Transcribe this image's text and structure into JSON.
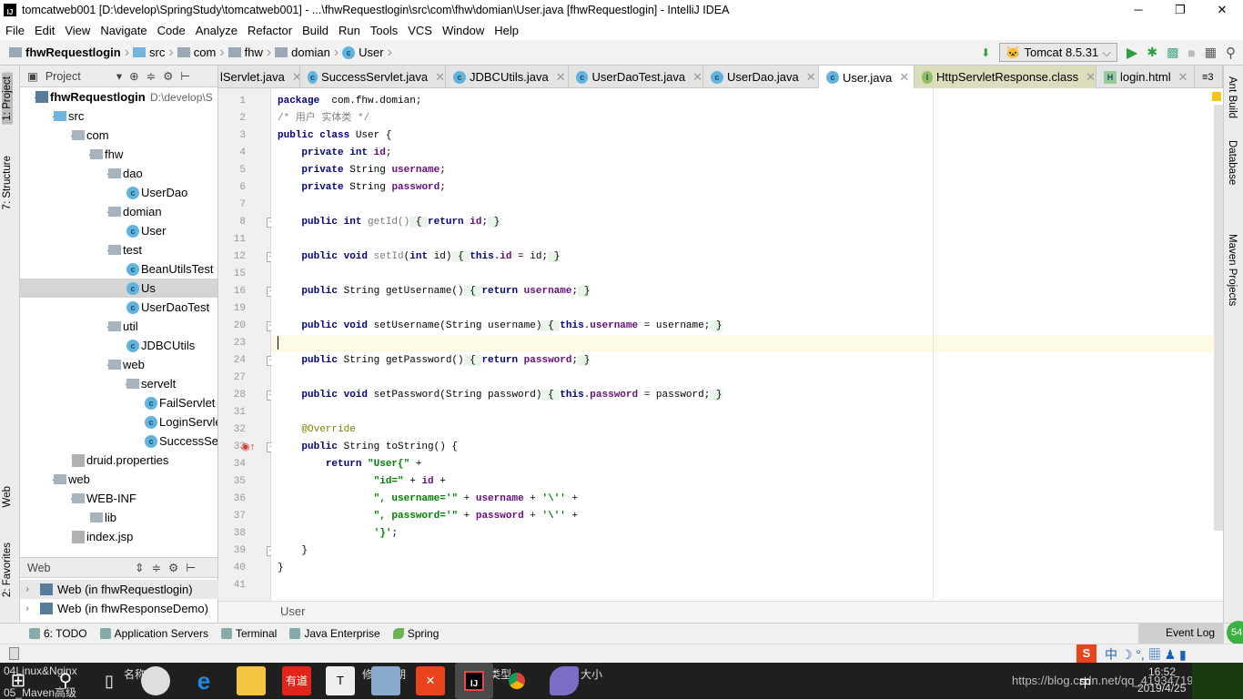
{
  "window": {
    "title": "tomcatweb001 [D:\\develop\\SpringStudy\\tomcatweb001] - ...\\fhwRequestlogin\\src\\com\\fhw\\domian\\User.java [fhwRequestlogin] - IntelliJ IDEA",
    "minimize": "─",
    "maximize": "❐",
    "close": "✕"
  },
  "menu": [
    "File",
    "Edit",
    "View",
    "Navigate",
    "Code",
    "Analyze",
    "Refactor",
    "Build",
    "Run",
    "Tools",
    "VCS",
    "Window",
    "Help"
  ],
  "breadcrumb": [
    "fhwRequestlogin",
    "src",
    "com",
    "fhw",
    "domian",
    "User"
  ],
  "run": {
    "config": "Tomcat 8.5.31"
  },
  "left_strip": [
    "1: Project",
    "7: Structure",
    "Web",
    "2: Favorites"
  ],
  "right_strip": [
    "Ant Build",
    "Database",
    "Maven Projects"
  ],
  "project": {
    "title": "Project",
    "root_path": "D:\\develop\\S",
    "tree": [
      {
        "label": "fhwRequestlogin",
        "depth": 0,
        "icon": "module",
        "exp": true,
        "bold": true
      },
      {
        "label": "src",
        "depth": 1,
        "icon": "src",
        "exp": true
      },
      {
        "label": "com",
        "depth": 2,
        "icon": "pkg",
        "exp": true
      },
      {
        "label": "fhw",
        "depth": 3,
        "icon": "pkg",
        "exp": true
      },
      {
        "label": "dao",
        "depth": 4,
        "icon": "pkg",
        "exp": true
      },
      {
        "label": "UserDao",
        "depth": 5,
        "icon": "class"
      },
      {
        "label": "domian",
        "depth": 4,
        "icon": "pkg",
        "exp": true
      },
      {
        "label": "User",
        "depth": 5,
        "icon": "class"
      },
      {
        "label": "test",
        "depth": 4,
        "icon": "pkg",
        "exp": true
      },
      {
        "label": "BeanUtilsTest",
        "depth": 5,
        "icon": "class"
      },
      {
        "label": "Us",
        "depth": 5,
        "icon": "class",
        "sel": true
      },
      {
        "label": "UserDaoTest",
        "depth": 5,
        "icon": "class"
      },
      {
        "label": "util",
        "depth": 4,
        "icon": "pkg",
        "exp": true
      },
      {
        "label": "JDBCUtils",
        "depth": 5,
        "icon": "class"
      },
      {
        "label": "web",
        "depth": 4,
        "icon": "pkg",
        "exp": true
      },
      {
        "label": "servelt",
        "depth": 5,
        "icon": "pkg",
        "exp": true
      },
      {
        "label": "FailServlet",
        "depth": 6,
        "icon": "class"
      },
      {
        "label": "LoginServle",
        "depth": 6,
        "icon": "class"
      },
      {
        "label": "SuccessSer",
        "depth": 6,
        "icon": "class"
      },
      {
        "label": "druid.properties",
        "depth": 2,
        "icon": "file"
      },
      {
        "label": "web",
        "depth": 1,
        "icon": "folder",
        "exp": true
      },
      {
        "label": "WEB-INF",
        "depth": 2,
        "icon": "folder",
        "exp": true
      },
      {
        "label": "lib",
        "depth": 3,
        "icon": "folder",
        "exp": false
      },
      {
        "label": "index.jsp",
        "depth": 2,
        "icon": "file"
      }
    ]
  },
  "web_panel": {
    "title": "Web",
    "items": [
      "Web (in fhwRequestlogin)",
      "Web (in fhwResponseDemo)"
    ]
  },
  "tabs": [
    {
      "label": "lServlet.java",
      "kind": "class"
    },
    {
      "label": "SuccessServlet.java",
      "kind": "class"
    },
    {
      "label": "JDBCUtils.java",
      "kind": "class"
    },
    {
      "label": "UserDaoTest.java",
      "kind": "class"
    },
    {
      "label": "UserDao.java",
      "kind": "class"
    },
    {
      "label": "User.java",
      "kind": "class",
      "active": true
    },
    {
      "label": "HttpServletResponse.class",
      "kind": "interface"
    },
    {
      "label": "login.html",
      "kind": "html"
    }
  ],
  "tabs_overflow": "≡3",
  "code": [
    {
      "n": 1,
      "t": [
        [
          "kw",
          "package"
        ],
        [
          "",
          "  com.fhw.domian;"
        ]
      ]
    },
    {
      "n": 2,
      "t": [
        [
          "cm",
          "/* 用户 实体类 */"
        ]
      ]
    },
    {
      "n": 3,
      "t": [
        [
          "kw",
          "public class"
        ],
        [
          "",
          " User {"
        ]
      ]
    },
    {
      "n": 4,
      "t": [
        [
          "",
          "    "
        ],
        [
          "kw",
          "private int"
        ],
        [
          "",
          " "
        ],
        [
          "fld",
          "id"
        ],
        [
          "",
          ";"
        ]
      ]
    },
    {
      "n": 5,
      "t": [
        [
          "",
          "    "
        ],
        [
          "kw",
          "private"
        ],
        [
          "",
          " String "
        ],
        [
          "fld",
          "username"
        ],
        [
          "",
          ";"
        ]
      ]
    },
    {
      "n": 6,
      "t": [
        [
          "",
          "    "
        ],
        [
          "kw",
          "private"
        ],
        [
          "",
          " String "
        ],
        [
          "fld",
          "password"
        ],
        [
          "",
          ";"
        ]
      ]
    },
    {
      "n": 7,
      "t": []
    },
    {
      "n": 8,
      "f": "+",
      "t": [
        [
          "",
          "    "
        ],
        [
          "kw",
          "public int"
        ],
        [
          "gray",
          " getId()"
        ],
        [
          "fb",
          " { "
        ],
        [
          "kw",
          "return"
        ],
        [
          "",
          " "
        ],
        [
          "fld",
          "id"
        ],
        [
          "",
          ";"
        ],
        [
          "fb",
          " }"
        ]
      ]
    },
    {
      "n": 11,
      "t": []
    },
    {
      "n": 12,
      "f": "+",
      "t": [
        [
          "",
          "    "
        ],
        [
          "kw",
          "public void"
        ],
        [
          "gray",
          " setId"
        ],
        [
          "",
          "("
        ],
        [
          "kw",
          "int"
        ],
        [
          "",
          " id)"
        ],
        [
          "fb",
          " { "
        ],
        [
          "kw",
          "this"
        ],
        [
          "",
          "."
        ],
        [
          "fld",
          "id"
        ],
        [
          "",
          " = id;"
        ],
        [
          "fb",
          " }"
        ]
      ]
    },
    {
      "n": 15,
      "t": []
    },
    {
      "n": 16,
      "f": "+",
      "t": [
        [
          "",
          "    "
        ],
        [
          "kw",
          "public"
        ],
        [
          "",
          " String getUsername()"
        ],
        [
          "fb",
          " { "
        ],
        [
          "kw",
          "return"
        ],
        [
          "",
          " "
        ],
        [
          "fld",
          "username"
        ],
        [
          "",
          ";"
        ],
        [
          "fb",
          " }"
        ]
      ]
    },
    {
      "n": 19,
      "t": []
    },
    {
      "n": 20,
      "f": "+",
      "t": [
        [
          "",
          "    "
        ],
        [
          "kw",
          "public void"
        ],
        [
          "",
          " setUsername(String username)"
        ],
        [
          "fb",
          " { "
        ],
        [
          "kw",
          "this"
        ],
        [
          "",
          "."
        ],
        [
          "fld",
          "username"
        ],
        [
          "",
          " = username;"
        ],
        [
          "fb",
          " }"
        ]
      ]
    },
    {
      "n": 23,
      "cur": true,
      "t": []
    },
    {
      "n": 24,
      "f": "+",
      "t": [
        [
          "",
          "    "
        ],
        [
          "kw",
          "public"
        ],
        [
          "",
          " String getPassword()"
        ],
        [
          "fb",
          " { "
        ],
        [
          "kw",
          "return"
        ],
        [
          "",
          " "
        ],
        [
          "fld",
          "password"
        ],
        [
          "",
          ";"
        ],
        [
          "fb",
          " }"
        ]
      ]
    },
    {
      "n": 27,
      "t": []
    },
    {
      "n": 28,
      "f": "+",
      "t": [
        [
          "",
          "    "
        ],
        [
          "kw",
          "public void"
        ],
        [
          "",
          " setPassword(String password)"
        ],
        [
          "fb",
          " { "
        ],
        [
          "kw",
          "this"
        ],
        [
          "",
          "."
        ],
        [
          "fld",
          "password"
        ],
        [
          "",
          " = password;"
        ],
        [
          "fb",
          " }"
        ]
      ]
    },
    {
      "n": 31,
      "t": []
    },
    {
      "n": 32,
      "t": [
        [
          "",
          "    "
        ],
        [
          "ann",
          "@Override"
        ]
      ]
    },
    {
      "n": 33,
      "f": "-",
      "override": true,
      "t": [
        [
          "",
          "    "
        ],
        [
          "kw",
          "public"
        ],
        [
          "",
          " String toString() {"
        ]
      ]
    },
    {
      "n": 34,
      "t": [
        [
          "",
          "        "
        ],
        [
          "kw",
          "return"
        ],
        [
          "",
          " "
        ],
        [
          "str",
          "\"User{\""
        ],
        [
          "",
          " +"
        ]
      ]
    },
    {
      "n": 35,
      "t": [
        [
          "",
          "                "
        ],
        [
          "str",
          "\"id=\""
        ],
        [
          "",
          " + "
        ],
        [
          "fld",
          "id"
        ],
        [
          "",
          " +"
        ]
      ]
    },
    {
      "n": 36,
      "t": [
        [
          "",
          "                "
        ],
        [
          "str",
          "\", username='\""
        ],
        [
          "",
          " + "
        ],
        [
          "fld",
          "username"
        ],
        [
          "",
          " + "
        ],
        [
          "str",
          "'\\''"
        ],
        [
          "",
          " +"
        ]
      ]
    },
    {
      "n": 37,
      "t": [
        [
          "",
          "                "
        ],
        [
          "str",
          "\", password='\""
        ],
        [
          "",
          " + "
        ],
        [
          "fld",
          "password"
        ],
        [
          "",
          " + "
        ],
        [
          "str",
          "'\\''"
        ],
        [
          "",
          " +"
        ]
      ]
    },
    {
      "n": 38,
      "t": [
        [
          "",
          "                "
        ],
        [
          "str",
          "'}'"
        ],
        [
          "",
          ";"
        ]
      ]
    },
    {
      "n": 39,
      "f": "-",
      "t": [
        [
          "",
          "    }"
        ]
      ]
    },
    {
      "n": 40,
      "t": [
        [
          "",
          "}"
        ]
      ]
    },
    {
      "n": 41,
      "t": []
    }
  ],
  "editor_breadcrumb": "User",
  "tool_windows": [
    "6: TODO",
    "Application Servers",
    "Terminal",
    "Java Enterprise",
    "Spring"
  ],
  "event_log": "Event Log",
  "memory_badge": "54",
  "taskbar": {
    "bg_texts": [
      "04Linux&Nginx",
      "05_Maven高级",
      "名称",
      "修改日期",
      "类型",
      "大小"
    ],
    "ime": "中",
    "time": "16:52",
    "date": "2019/4/25",
    "watermark": "https://blog.csdn.net/qq_41934719",
    "youdao": "有道"
  },
  "colors": {
    "keyword": "#000080",
    "field": "#660e7a",
    "string": "#008000",
    "annotation": "#808000",
    "run": "#2ea043"
  }
}
